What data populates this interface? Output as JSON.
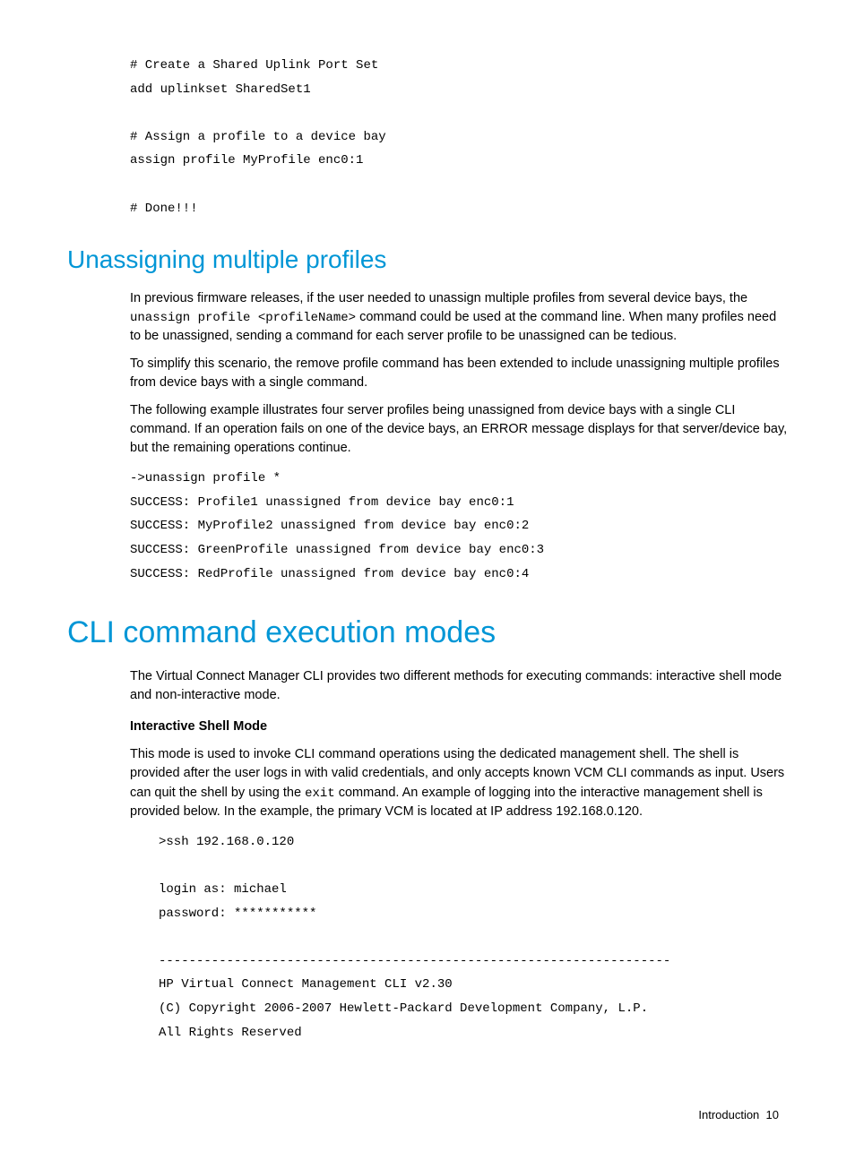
{
  "code1": "# Create a Shared Uplink Port Set\nadd uplinkset SharedSet1\n\n# Assign a profile to a device bay\nassign profile MyProfile enc0:1\n\n# Done!!!",
  "h2_unassign": "Unassigning multiple profiles",
  "p_unassign_1a": "In previous firmware releases, if the user needed to unassign multiple profiles from several device bays, the ",
  "p_unassign_1b": "unassign profile <profileName>",
  "p_unassign_1c": " command could be used at the command line. When many profiles need to be unassigned, sending a command for each server profile to be unassigned can be tedious.",
  "p_unassign_2": "To simplify this scenario, the remove profile command has been extended to include unassigning multiple profiles from device bays with a single command.",
  "p_unassign_3": "The following example illustrates four server profiles being unassigned from device bays with a single CLI command. If an operation fails on one of the device bays, an ERROR message displays for that server/device bay, but the remaining operations continue.",
  "code2": "->unassign profile *\nSUCCESS: Profile1 unassigned from device bay enc0:1\nSUCCESS: MyProfile2 unassigned from device bay enc0:2\nSUCCESS: GreenProfile unassigned from device bay enc0:3\nSUCCESS: RedProfile unassigned from device bay enc0:4",
  "h1_cli": "CLI command execution modes",
  "p_cli_1": "The Virtual Connect Manager CLI provides two different methods for executing commands: interactive shell mode and non-interactive mode.",
  "sub_interactive": "Interactive Shell Mode",
  "p_cli_2a": "This mode is used to invoke CLI command operations using the dedicated management shell. The shell is provided after the user logs in with valid credentials, and only accepts known VCM CLI commands as input. Users can quit the shell by using the ",
  "p_cli_2b": "exit",
  "p_cli_2c": " command. An example of logging into the interactive management shell is provided below. In the example, the primary VCM is located at IP address 192.168.0.120.",
  "code3": ">ssh 192.168.0.120\n\nlogin as: michael\npassword: ***********\n\n--------------------------------------------------------------------\nHP Virtual Connect Management CLI v2.30\n(C) Copyright 2006-2007 Hewlett-Packard Development Company, L.P.\nAll Rights Reserved",
  "footer_label": "Introduction",
  "footer_page": "10"
}
